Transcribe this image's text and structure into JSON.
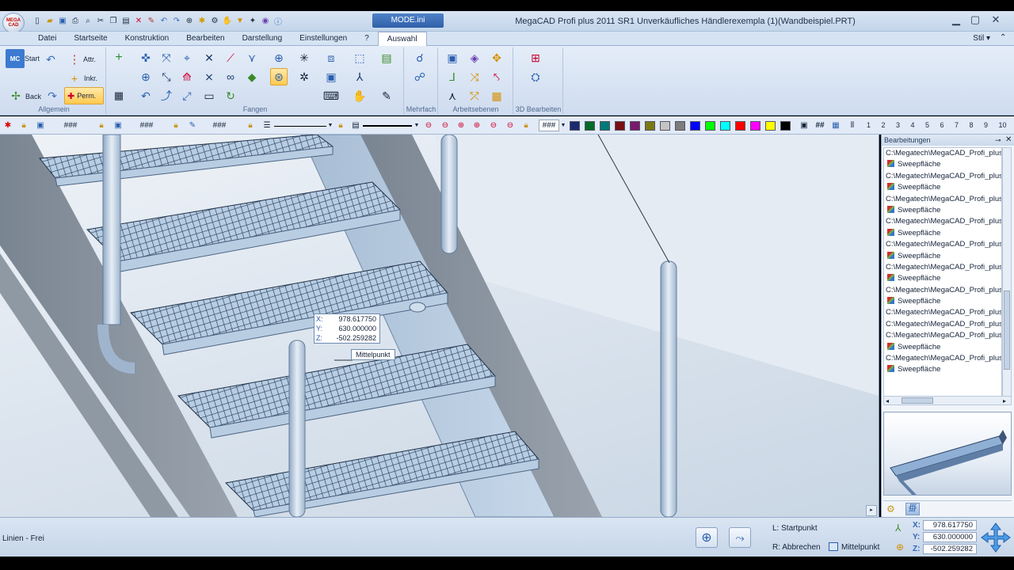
{
  "app": {
    "logo_text": "MEGA CAD",
    "mode_tab": "MODE.ini",
    "window_title": "MegaCAD Profi plus 2011 SR1  Unverkäufliches Händlerexempla (1)(Wandbeispiel.PRT)"
  },
  "menu": {
    "items": [
      "Datei",
      "Startseite",
      "Konstruktion",
      "Bearbeiten",
      "Darstellung",
      "Einstellungen",
      "?",
      "Auswahl"
    ],
    "active": "Auswahl",
    "style_label": "Stil"
  },
  "ribbon": {
    "allgemein": {
      "label": "Allgemein",
      "start": "Start",
      "attr": "Attr.",
      "inkr": "Inkr.",
      "back": "Back",
      "perm": "Perm."
    },
    "fangen": {
      "label": "Fangen"
    },
    "mehrfach": {
      "label": "Mehrfach"
    },
    "arbeitsebenen": {
      "label": "Arbeitsebenen"
    },
    "bearbeiten3d": {
      "label": "3D Bearbeiten"
    }
  },
  "toolbar": {
    "hash_fields": [
      "###",
      "###",
      "###",
      "###"
    ],
    "colors": [
      "#1a2a6e",
      "#006a28",
      "#007a78",
      "#7a0f12",
      "#7a1a6c",
      "#7a7a14",
      "#c4c4c4",
      "#7c7c7c",
      "#0000ff",
      "#00ff00",
      "#00ffff",
      "#ff0000",
      "#ff00ff",
      "#ffff00",
      "#000000"
    ],
    "layer_numbers": [
      "1",
      "2",
      "3",
      "4",
      "5",
      "6",
      "7",
      "8",
      "9",
      "10"
    ]
  },
  "viewport": {
    "coord_tooltip": {
      "x_label": "X:",
      "x": "978.617750",
      "y_label": "Y:",
      "y": "630.000000",
      "z_label": "Z:",
      "z": "-502.259282"
    },
    "snap_label": "Mittelpunkt"
  },
  "sidebar": {
    "title": "Bearbeitungen",
    "history": [
      {
        "text": "C:\\Megatech\\MegaCAD_Profi_plus",
        "kind": "path"
      },
      {
        "text": "Sweepfläche",
        "kind": "sweep"
      },
      {
        "text": "C:\\Megatech\\MegaCAD_Profi_plus",
        "kind": "path"
      },
      {
        "text": "Sweepfläche",
        "kind": "sweep"
      },
      {
        "text": "C:\\Megatech\\MegaCAD_Profi_plus",
        "kind": "path"
      },
      {
        "text": "Sweepfläche",
        "kind": "sweep"
      },
      {
        "text": "C:\\Megatech\\MegaCAD_Profi_plus",
        "kind": "path"
      },
      {
        "text": "Sweepfläche",
        "kind": "sweep"
      },
      {
        "text": "C:\\Megatech\\MegaCAD_Profi_plus",
        "kind": "path"
      },
      {
        "text": "Sweepfläche",
        "kind": "sweep"
      },
      {
        "text": "C:\\Megatech\\MegaCAD_Profi_plus",
        "kind": "path"
      },
      {
        "text": "Sweepfläche",
        "kind": "sweep"
      },
      {
        "text": "C:\\Megatech\\MegaCAD_Profi_plus",
        "kind": "path"
      },
      {
        "text": "Sweepfläche",
        "kind": "sweep"
      },
      {
        "text": "C:\\Megatech\\MegaCAD_Profi_plus",
        "kind": "path"
      },
      {
        "text": "C:\\Megatech\\MegaCAD_Profi_plus",
        "kind": "path"
      },
      {
        "text": "C:\\Megatech\\MegaCAD_Profi_plus",
        "kind": "path"
      },
      {
        "text": "Sweepfläche",
        "kind": "sweep"
      },
      {
        "text": "C:\\Megatech\\MegaCAD_Profi_plus",
        "kind": "path"
      },
      {
        "text": "Sweepfläche",
        "kind": "sweep"
      }
    ]
  },
  "status": {
    "mode_text": "Linien - Frei",
    "left_click_hint": "L: Startpunkt",
    "right_click_hint": "R: Abbrechen",
    "snap_mode": "Mittelpunkt",
    "coords": {
      "x_label": "X:",
      "x": "978.617750",
      "y_label": "Y:",
      "y": "630.000000",
      "z_label": "Z:",
      "z": "-502.259282"
    }
  },
  "icons": [
    "close-icon",
    "minimize-icon",
    "maximize-icon",
    "undo-icon",
    "redo-icon",
    "pin-icon",
    "navigate-icon"
  ]
}
